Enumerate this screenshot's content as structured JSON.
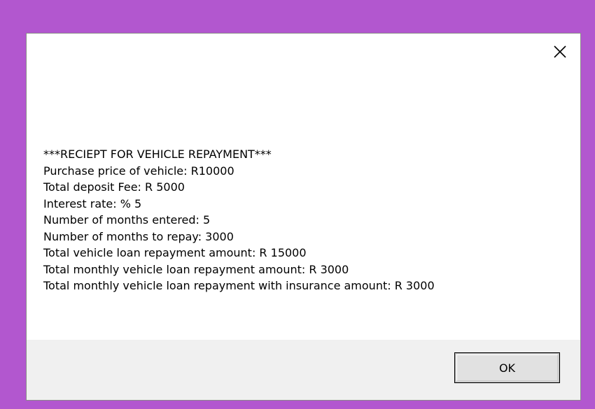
{
  "dialog": {
    "close_label": "Close",
    "message_lines": [
      "***RECIEPT FOR VEHICLE REPAYMENT***",
      "Purchase price of vehicle: R10000",
      "Total deposit Fee: R 5000",
      "Interest rate: % 5",
      "Number of months entered: 5",
      "Number of months to repay: 3000",
      "Total vehicle loan repayment amount: R 15000",
      "Total monthly vehicle loan repayment amount: R 3000",
      "Total monthly vehicle loan repayment with insurance amount: R 3000"
    ],
    "ok_label": "OK"
  },
  "colors": {
    "desktop": "#b257cf",
    "dialog_body": "#ffffff",
    "footer": "#f0f0f0"
  }
}
